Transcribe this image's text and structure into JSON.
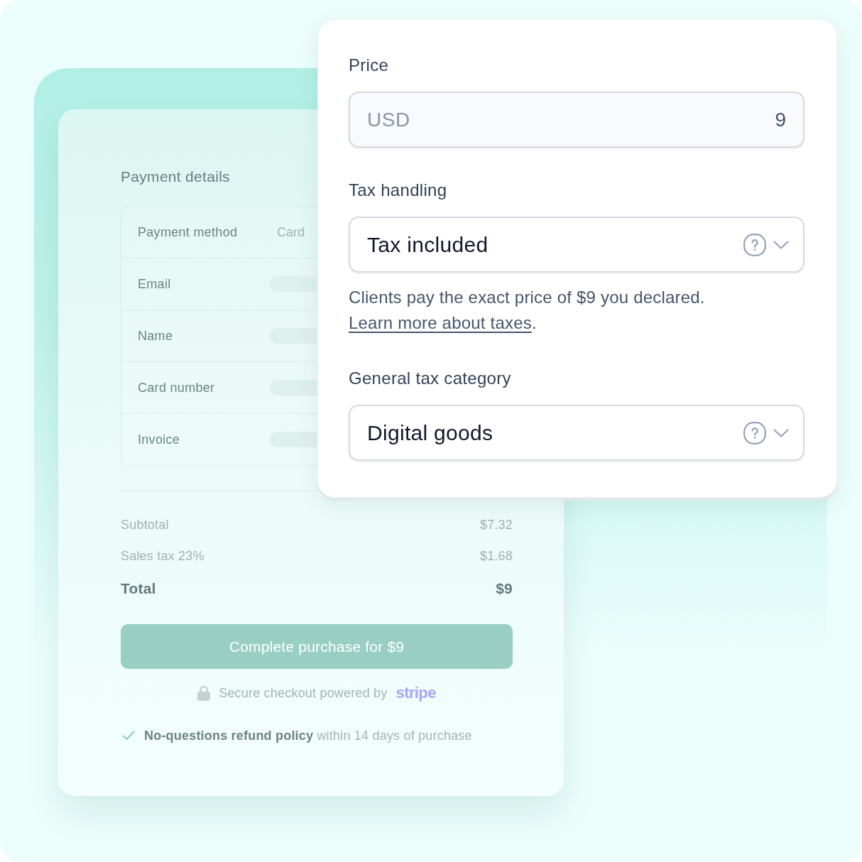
{
  "checkout": {
    "title": "Payment details",
    "rows": [
      {
        "kind": "value",
        "label": "Payment method",
        "value": "Card"
      },
      {
        "kind": "blank",
        "label": "Email"
      },
      {
        "kind": "blank",
        "label": "Name"
      },
      {
        "kind": "blank",
        "label": "Card number"
      },
      {
        "kind": "blank",
        "label": "Invoice"
      }
    ],
    "summary": [
      {
        "kind": "line",
        "label": "Subtotal",
        "amount": "$7.32"
      },
      {
        "kind": "line",
        "label": "Sales tax 23%",
        "amount": "$1.68"
      },
      {
        "kind": "total",
        "label": "Total",
        "amount": "$9"
      }
    ],
    "button": "Complete purchase for $9",
    "secure": {
      "text": "Secure checkout powered by",
      "brand": "stripe"
    },
    "refund": "**No-questions refund policy** within 14 days of purchase"
  },
  "settings": {
    "fields": [
      {
        "kind": "price",
        "label": "Price",
        "currency": "USD",
        "value": "9"
      },
      {
        "kind": "select",
        "label": "Tax handling",
        "value": "Tax included",
        "note": {
          "text": "Clients pay the exact price of $9 you declared.",
          "link": "Learn more about taxes",
          "end": "."
        }
      },
      {
        "kind": "select",
        "label": "General tax category",
        "value": "Digital goods"
      }
    ]
  }
}
